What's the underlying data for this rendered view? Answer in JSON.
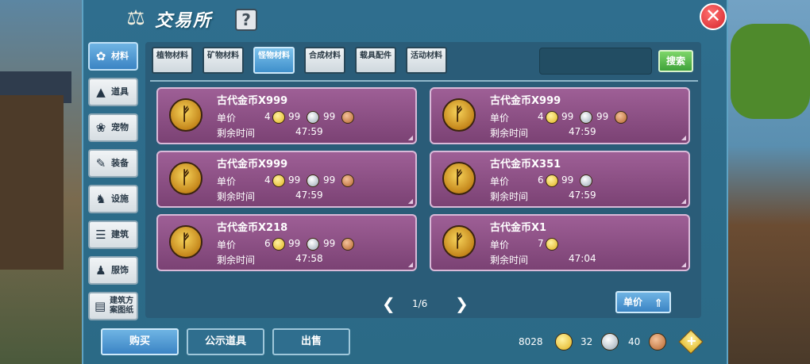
{
  "window": {
    "title": "交易所",
    "help": "?",
    "close": "✕"
  },
  "sidebar": [
    {
      "label": "材料",
      "icon": "materials-icon",
      "glyph": "✿",
      "active": true
    },
    {
      "label": "道具",
      "icon": "tool-icon",
      "glyph": "▲",
      "active": false
    },
    {
      "label": "宠物",
      "icon": "paw-icon",
      "glyph": "❀",
      "active": false
    },
    {
      "label": "装备",
      "icon": "equipment-icon",
      "glyph": "✎",
      "active": false
    },
    {
      "label": "设施",
      "icon": "facility-icon",
      "glyph": "♞",
      "active": false
    },
    {
      "label": "建筑",
      "icon": "building-icon",
      "glyph": "☰",
      "active": false
    },
    {
      "label": "服饰",
      "icon": "clothing-icon",
      "glyph": "♟",
      "active": false
    },
    {
      "label": "建筑方案图纸",
      "icon": "blueprint-icon",
      "glyph": "▤",
      "active": false
    }
  ],
  "tabs": [
    {
      "label": "植物材料",
      "active": false
    },
    {
      "label": "矿物材料",
      "active": false
    },
    {
      "label": "怪物材料",
      "active": true
    },
    {
      "label": "合成材料",
      "active": false
    },
    {
      "label": "载具配件",
      "active": false
    },
    {
      "label": "活动材料",
      "active": false
    }
  ],
  "search": {
    "value": "",
    "button": "搜索"
  },
  "labels": {
    "unit_price": "单价",
    "remaining": "剩余时间"
  },
  "listings": [
    {
      "name": "古代金币X999",
      "gold": "4",
      "silver": "99",
      "copper": "99",
      "time": "47:59"
    },
    {
      "name": "古代金币X999",
      "gold": "4",
      "silver": "99",
      "copper": "99",
      "time": "47:59"
    },
    {
      "name": "古代金币X999",
      "gold": "4",
      "silver": "99",
      "copper": "99",
      "time": "47:59"
    },
    {
      "name": "古代金币X351",
      "gold": "6",
      "silver": "99",
      "copper": "",
      "time": "47:59"
    },
    {
      "name": "古代金币X218",
      "gold": "6",
      "silver": "99",
      "copper": "99",
      "time": "47:58"
    },
    {
      "name": "古代金币X1",
      "gold": "7",
      "silver": "",
      "copper": "",
      "time": "47:04"
    }
  ],
  "pager": {
    "prev": "❮",
    "page": "1/6",
    "next": "❯"
  },
  "sort": {
    "label": "单价",
    "icon": "sort-arrow-icon",
    "glyph": "⇑"
  },
  "bottom": {
    "buy": "购买",
    "public": "公示道具",
    "sell": "出售"
  },
  "wallet": {
    "gold": "8028",
    "silver": "32",
    "copper": "40",
    "add": "+"
  },
  "colors": {
    "accent": "#3b84c4",
    "card": "#8b4d84",
    "search": "#3fa23a",
    "close": "#d4252b"
  }
}
